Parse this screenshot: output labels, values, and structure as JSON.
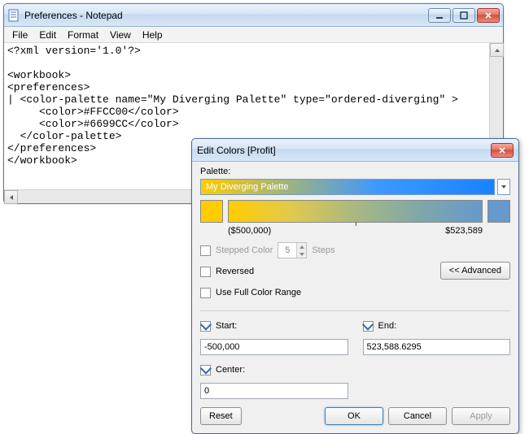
{
  "notepad": {
    "title": "Preferences - Notepad",
    "menu": {
      "file": "File",
      "edit": "Edit",
      "format": "Format",
      "view": "View",
      "help": "Help"
    },
    "content": "<?xml version='1.0'?>\n\n<workbook>\n<preferences>\n| <color-palette name=\"My Diverging Palette\" type=\"ordered-diverging\" >\n     <color>#FFCC00</color>\n     <color>#6699CC</color>\n  </color-palette>\n</preferences>\n</workbook>"
  },
  "dialog": {
    "title": "Edit Colors [Profit]",
    "palette_label": "Palette:",
    "palette_name": "My Diverging Palette",
    "swatch_left": "#FFCC00",
    "swatch_right": "#6699CC",
    "range_min": "($500,000)",
    "range_max": "$523,589",
    "stepped_label": "Stepped Color",
    "stepped_value": "5",
    "steps_label": "Steps",
    "reversed_label": "Reversed",
    "fullrange_label": "Use Full Color Range",
    "advanced_label": "<< Advanced",
    "start_label": "Start:",
    "start_value": "-500,000",
    "end_label": "End:",
    "end_value": "523,588.6295",
    "center_label": "Center:",
    "center_value": "0",
    "reset": "Reset",
    "ok": "OK",
    "cancel": "Cancel",
    "apply": "Apply",
    "start_checked": true,
    "end_checked": true,
    "center_checked": true
  }
}
